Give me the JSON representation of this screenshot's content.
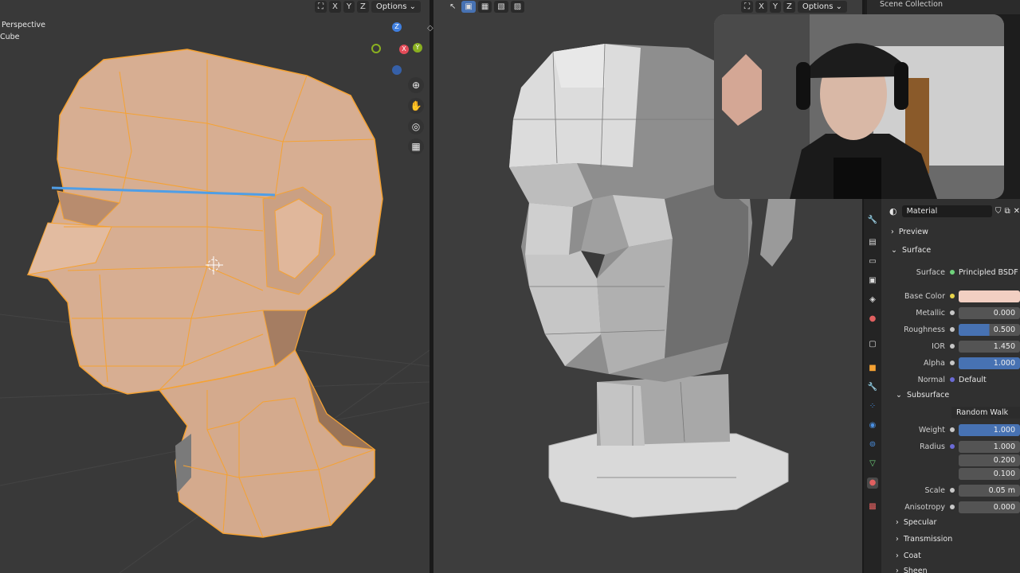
{
  "left_viewport": {
    "header": {
      "axis_x": "X",
      "axis_y": "Y",
      "axis_z": "Z",
      "options_label": "Options"
    },
    "overlay_view": "Perspective",
    "overlay_object": "Cube",
    "gizmo": {
      "z": "Z",
      "x": "X",
      "y": "Y"
    }
  },
  "right_viewport": {
    "header": {
      "axis_x": "X",
      "axis_y": "Y",
      "axis_z": "Z",
      "options_label": "Options"
    }
  },
  "outliner": {
    "title": "Scene Collection"
  },
  "properties": {
    "material_name": "Material",
    "preview_label": "Preview",
    "surface_label": "Surface",
    "rows": [
      {
        "label": "Surface",
        "value": "Principled BSDF"
      },
      {
        "label": "Base Color",
        "value": ""
      },
      {
        "label": "Metallic",
        "value": "0.000"
      },
      {
        "label": "Roughness",
        "value": "0.500"
      },
      {
        "label": "IOR",
        "value": "1.450"
      },
      {
        "label": "Alpha",
        "value": "1.000"
      },
      {
        "label": "Normal",
        "value": "Default"
      }
    ],
    "subsurface_label": "Subsurface",
    "subsurface_method": "Random Walk",
    "sub_rows": [
      {
        "label": "Weight",
        "value": "1.000"
      },
      {
        "label": "Radius",
        "value": "1.000"
      },
      {
        "label": "",
        "value": "0.200"
      },
      {
        "label": "",
        "value": "0.100"
      },
      {
        "label": "Scale",
        "value": "0.05 m"
      },
      {
        "label": "Anisotropy",
        "value": "0.000"
      }
    ],
    "collapsed": [
      "Specular",
      "Transmission",
      "Coat",
      "Sheen"
    ]
  },
  "colors": {
    "selection": "#f5a233",
    "mesh_fill": "#d8ae92",
    "base_color": "#f2cfc2",
    "active_field": "#4772b3"
  }
}
